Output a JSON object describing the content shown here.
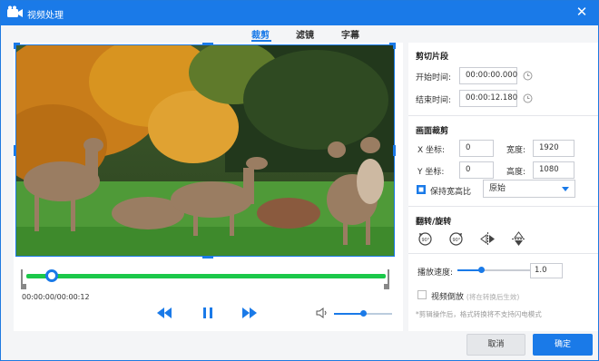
{
  "window": {
    "title": "视频处理",
    "close_label": "✕"
  },
  "tabs": [
    {
      "label": "裁剪",
      "active": true
    },
    {
      "label": "滤镜",
      "active": false
    },
    {
      "label": "字幕",
      "active": false
    }
  ],
  "player": {
    "timecode": "00:00:00/00:00:12",
    "progress_fraction": 0.07,
    "volume_fraction": 0.5
  },
  "trim": {
    "section_title": "剪切片段",
    "start_label": "开始时间:",
    "start_value": "00:00:00.000",
    "end_label": "结束时间:",
    "end_value": "00:00:12.180"
  },
  "crop": {
    "section_title": "画面裁剪",
    "x_label": "X 坐标:",
    "x_value": "0",
    "width_label": "宽度:",
    "width_value": "1920",
    "y_label": "Y 坐标:",
    "y_value": "0",
    "height_label": "高度:",
    "height_value": "1080",
    "keep_ratio_label": "保持宽高比",
    "keep_ratio_checked": true,
    "ratio_value": "原始"
  },
  "flip": {
    "section_title": "翻转/旋转",
    "icons": [
      "rotate-left-90-icon",
      "rotate-right-90-icon",
      "flip-horizontal-icon",
      "flip-vertical-icon"
    ]
  },
  "speed": {
    "label": "播放速度:",
    "value": "1.0",
    "fraction": 0.33
  },
  "reverse": {
    "label": "视频倒放",
    "hint": "(将在转换后生效)",
    "checked": false
  },
  "note": "*剪辑操作后，格式转换将不支持闪电模式",
  "footer": {
    "cancel_label": "取消",
    "ok_label": "确定"
  },
  "colors": {
    "accent": "#1a7ae8",
    "timeline": "#1bc84a"
  }
}
